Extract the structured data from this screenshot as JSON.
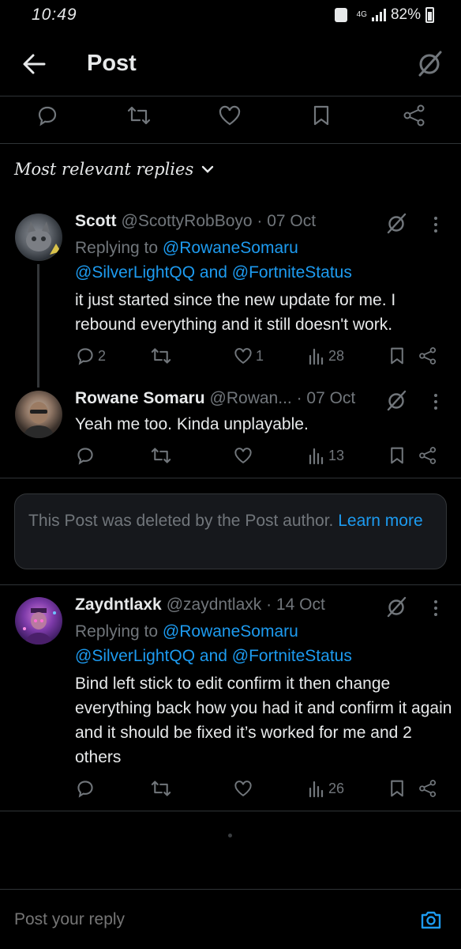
{
  "status_bar": {
    "time": "10:49",
    "network": "4G",
    "battery": "82%"
  },
  "header": {
    "title": "Post"
  },
  "actions_icons": [
    "reply-icon",
    "repost-icon",
    "like-icon",
    "bookmark-icon",
    "share-icon"
  ],
  "sort": {
    "label": "Most relevant replies"
  },
  "replies": [
    {
      "author": "Scott",
      "handle": "@ScottyRobBoyo · 07 Oct",
      "replying_prefix": "Replying to",
      "replying_to": "@RowaneSomaru",
      "replying_line2_a": "@SilverLightQQ",
      "replying_and": "and",
      "replying_line2_b": "@FortniteStatus",
      "text": "it just started since the new update for me. I rebound everything and it still doesn't work.",
      "replies_count": "2",
      "reposts_count": "",
      "likes_count": "1",
      "views_count": "28"
    },
    {
      "author": "Rowane Somaru",
      "handle": "@Rowan... · 07 Oct",
      "text": "Yeah me too. Kinda unplayable.",
      "replies_count": "",
      "reposts_count": "",
      "likes_count": "",
      "views_count": "13"
    },
    {
      "author": "Zaydntlaxk",
      "handle": "@zaydntlaxk · 14 Oct",
      "replying_prefix": "Replying to",
      "replying_to": "@RowaneSomaru",
      "replying_line2_a": "@SilverLightQQ",
      "replying_and": "and",
      "replying_line2_b": "@FortniteStatus",
      "text": "Bind left stick to edit confirm it then change everything back how you had it and confirm it again and it should be fixed it’s worked for me and 2 others",
      "replies_count": "",
      "reposts_count": "",
      "likes_count": "",
      "views_count": "26"
    }
  ],
  "deleted_notice": {
    "text": "This Post was deleted by the Post author.",
    "link": "Learn more"
  },
  "composer": {
    "placeholder": "Post your reply"
  },
  "colors": {
    "background": "#000000",
    "text": "#e7e9ea",
    "muted": "#71767b",
    "accent": "#1d9bf0",
    "divider": "#2f3336"
  }
}
